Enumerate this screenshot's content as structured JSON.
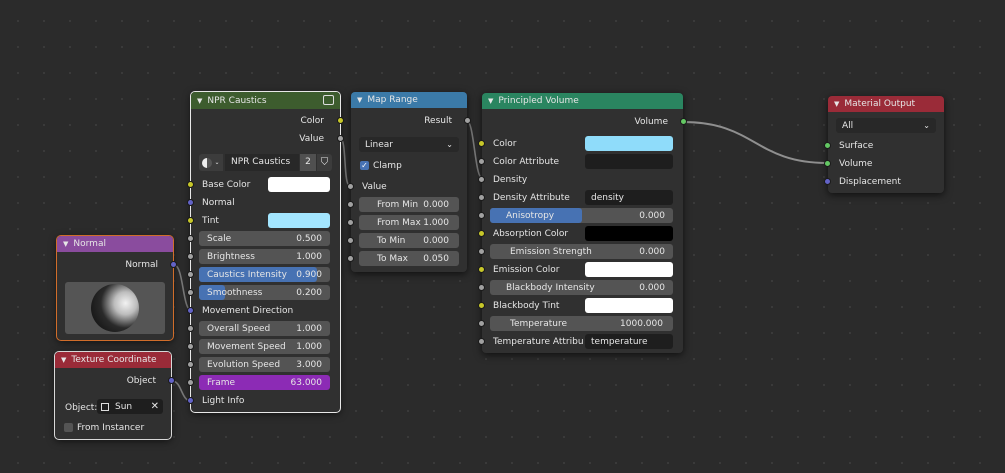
{
  "npr": {
    "title": "NPR Caustics",
    "out_color": "Color",
    "out_value": "Value",
    "datablock_name": "NPR Caustics",
    "datablock_users": "2",
    "base_color": "Base Color",
    "base_color_hex": "#ffffff",
    "normal": "Normal",
    "tint": "Tint",
    "tint_hex": "#a3e6ff",
    "scale_label": "Scale",
    "scale_value": "0.500",
    "brightness_label": "Brightness",
    "brightness_value": "1.000",
    "caustics_label": "Caustics Intensity",
    "caustics_value": "0.900",
    "smoothness_label": "Smoothness",
    "smoothness_value": "0.200",
    "movement_direction": "Movement Direction",
    "overall_speed_label": "Overall Speed",
    "overall_speed_value": "1.000",
    "movement_speed_label": "Movement Speed",
    "movement_speed_value": "1.000",
    "evolution_speed_label": "Evolution Speed",
    "evolution_speed_value": "3.000",
    "frame_label": "Frame",
    "frame_value": "63.000",
    "light_info": "Light Info"
  },
  "normal_node": {
    "title": "Normal",
    "out_normal": "Normal"
  },
  "texcoord": {
    "title": "Texture Coordinate",
    "out_object": "Object",
    "object_label": "Object:",
    "object_value": "Sun",
    "from_instancer": "From Instancer"
  },
  "map_range": {
    "title": "Map Range",
    "out_result": "Result",
    "interpolation": "Linear",
    "clamp": "Clamp",
    "in_value": "Value",
    "from_min_label": "From Min",
    "from_min_value": "0.000",
    "from_max_label": "From Max",
    "from_max_value": "1.000",
    "to_min_label": "To Min",
    "to_min_value": "0.000",
    "to_max_label": "To Max",
    "to_max_value": "0.050"
  },
  "pvol": {
    "title": "Principled Volume",
    "out_volume": "Volume",
    "color": "Color",
    "color_hex": "#8fdcfa",
    "color_attribute": "Color Attribute",
    "color_attribute_value": "",
    "density": "Density",
    "density_attribute": "Density Attribute",
    "density_attribute_value": "density",
    "anisotropy_label": "Anisotropy",
    "anisotropy_value": "0.000",
    "absorption_color": "Absorption Color",
    "absorption_hex": "#000000",
    "emission_strength_label": "Emission Strength",
    "emission_strength_value": "0.000",
    "emission_color": "Emission Color",
    "emission_hex": "#ffffff",
    "blackbody_intensity_label": "Blackbody Intensity",
    "blackbody_intensity_value": "0.000",
    "blackbody_tint": "Blackbody Tint",
    "blackbody_tint_hex": "#ffffff",
    "temperature_label": "Temperature",
    "temperature_value": "1000.000",
    "temperature_attribute": "Temperature Attribu",
    "temperature_attribute_value": "temperature"
  },
  "output": {
    "title": "Material Output",
    "target": "All",
    "surface": "Surface",
    "volume": "Volume",
    "displacement": "Displacement"
  },
  "colors": {
    "group_header": "#3d5c2e",
    "converter_header": "#3b7aa8",
    "shader_header": "#2a8560",
    "input_header": "#8a4c9e",
    "output_header": "#9a2b38",
    "accent": "#4772b3"
  }
}
